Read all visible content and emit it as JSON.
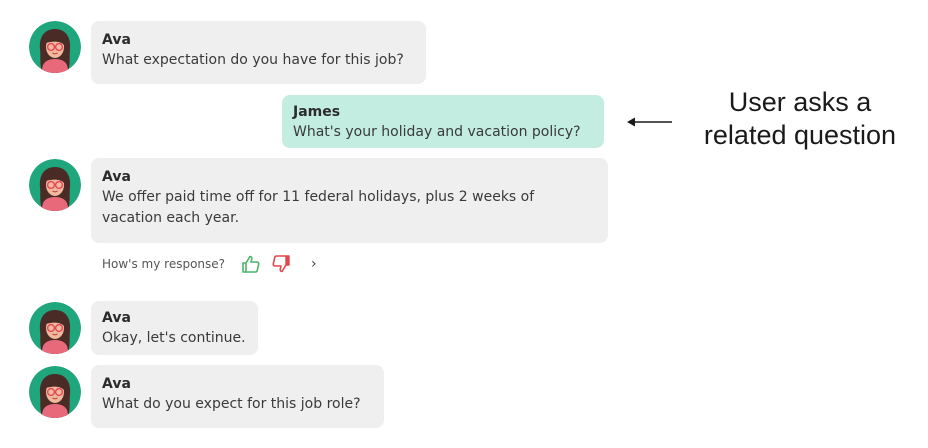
{
  "colors": {
    "bot_bubble": "#efefef",
    "user_bubble": "#c2ede0",
    "avatar_bg": "#20a67c",
    "thumbs_up": "#4cb36a",
    "thumbs_down": "#e0484d"
  },
  "messages": [
    {
      "sender": "Ava",
      "text": "What expectation do you have for this job?",
      "role": "bot"
    },
    {
      "sender": "James",
      "text": "What's your holiday and vacation policy?",
      "role": "user"
    },
    {
      "sender": "Ava",
      "text": "We offer paid time off for 11 federal holidays, plus 2 weeks of vacation each year.",
      "role": "bot"
    },
    {
      "sender": "Ava",
      "text": "Okay, let's continue.",
      "role": "bot"
    },
    {
      "sender": "Ava",
      "text": "What do you expect for this job role?",
      "role": "bot"
    }
  ],
  "feedback": {
    "label": "How's my response?",
    "up_icon": "thumbs-up-icon",
    "down_icon": "thumbs-down-icon",
    "more_icon": "chevron-right-icon",
    "more_glyph": "›"
  },
  "annotation": {
    "line1": "User asks a",
    "line2": "related question"
  }
}
